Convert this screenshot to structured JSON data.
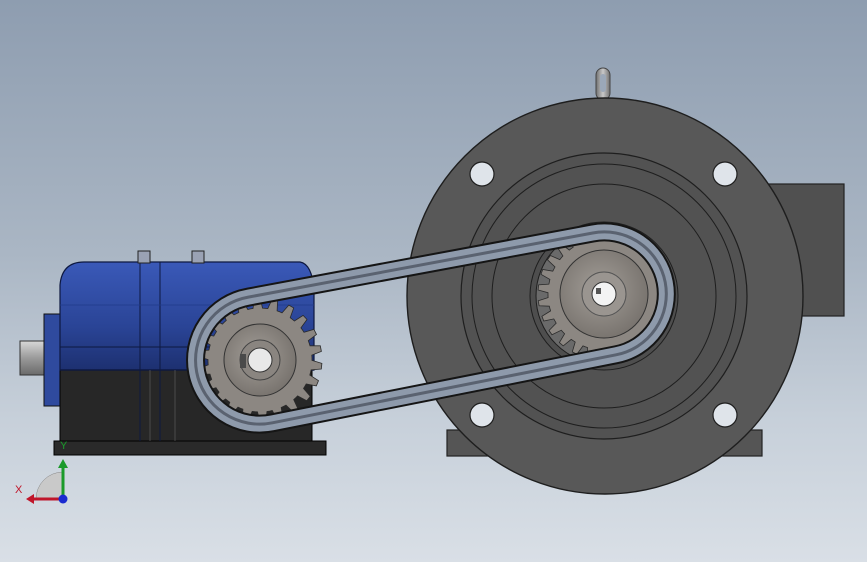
{
  "viewport": {
    "background_top": "#8e9db0",
    "background_bottom": "#d9dfe6"
  },
  "model": {
    "parts": [
      "gearbox",
      "belt",
      "small-pulley",
      "large-pulley",
      "motor"
    ],
    "gearbox_color": "#2a4496",
    "motor_color": "#585858",
    "pulley_color": "#8c8782"
  },
  "triad": {
    "x_label": "X",
    "y_label": "Y",
    "x_color": "#c0162a",
    "y_color": "#1a9a2a",
    "z_color": "#1a2ad0"
  }
}
